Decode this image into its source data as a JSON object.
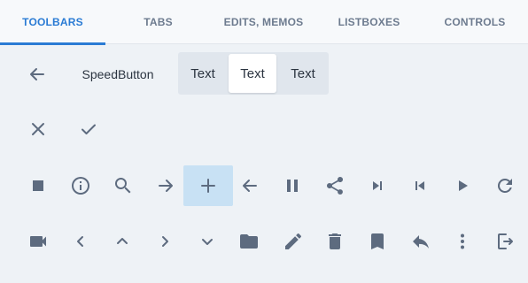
{
  "tabs": [
    {
      "label": "TOOLBARS",
      "active": true
    },
    {
      "label": "TABS",
      "active": false
    },
    {
      "label": "EDITS, MEMOS",
      "active": false
    },
    {
      "label": "LISTBOXES",
      "active": false
    },
    {
      "label": "CONTROLS",
      "active": false
    }
  ],
  "toolbar1": {
    "back_icon": "arrow-left-icon",
    "speed_button_label": "SpeedButton",
    "segments": [
      {
        "label": "Text",
        "active": false
      },
      {
        "label": "Text",
        "active": true
      },
      {
        "label": "Text",
        "active": false
      }
    ]
  },
  "toolbar2": {
    "icons": [
      "close-icon",
      "check-icon"
    ]
  },
  "toolbar3": {
    "icons": [
      "stop-icon",
      "info-icon",
      "search-icon",
      "arrow-right-icon",
      "add-icon",
      "arrow-left-icon",
      "pause-icon",
      "share-icon",
      "skip-next-icon",
      "skip-previous-icon",
      "play-icon",
      "refresh-icon"
    ],
    "highlighted": "add-icon"
  },
  "toolbar4": {
    "icons": [
      "videocam-icon",
      "chevron-left-icon",
      "chevron-up-icon",
      "chevron-right-icon",
      "chevron-down-icon",
      "folder-icon",
      "edit-icon",
      "delete-icon",
      "bookmark-icon",
      "reply-icon",
      "more-vert-icon",
      "exit-icon"
    ]
  },
  "colors": {
    "accent": "#2a7bd4",
    "icon": "#5d6b7f",
    "background": "#eef2f6",
    "highlight": "#c8e1f4"
  }
}
